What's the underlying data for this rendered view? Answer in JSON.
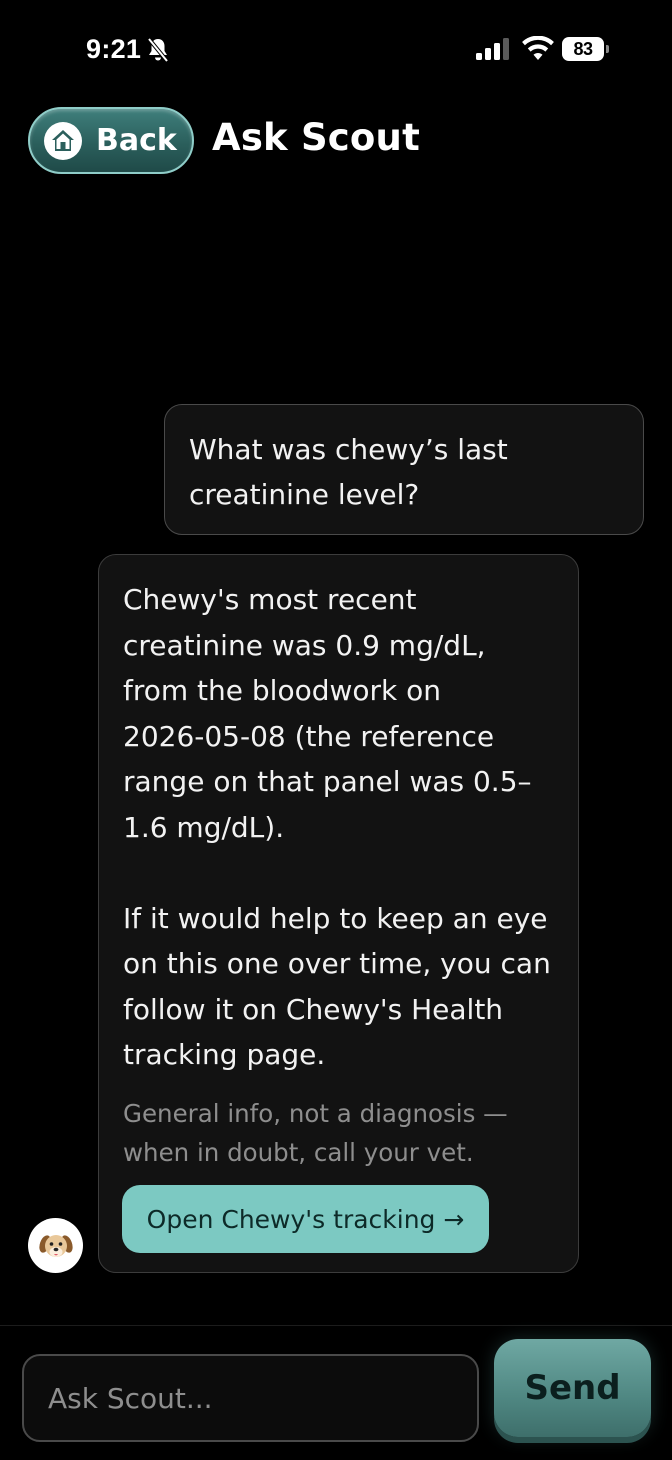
{
  "status_bar": {
    "time": "9:21",
    "battery": "83",
    "icons": [
      "bell-slash-icon",
      "signal-icon",
      "wifi-icon",
      "battery-icon"
    ]
  },
  "header": {
    "back_label": "Back",
    "back_icon": "home-icon",
    "title": "Ask Scout"
  },
  "messages": [
    {
      "role": "user",
      "text": "What was chewy’s last\ncreatinine level?"
    },
    {
      "role": "assistant",
      "paragraph_1": "Chewy's most recent\ncreatinine was 0.9 mg/dL,\nfrom the bloodwork on\n2026-05-08 (the reference\nrange on that panel was 0.5–\n1.6 mg/dL).",
      "paragraph_2": "If it would help to keep an eye\non this one over time, you can\nfollow it on Chewy's Health\ntracking page.",
      "disclaimer": "General info, not a diagnosis —\nwhen in doubt, call your vet.",
      "action_label": "Open Chewy's tracking →",
      "avatar_icon": "dog-avatar-icon"
    }
  ],
  "composer": {
    "placeholder": "Ask Scout...",
    "value": "",
    "send_label": "Send"
  },
  "colors": {
    "background": "#000000",
    "bubble": "#121212",
    "accent": "#7cc9c2",
    "back_button": "#2b5f5c",
    "send_button": "#4f8782"
  }
}
